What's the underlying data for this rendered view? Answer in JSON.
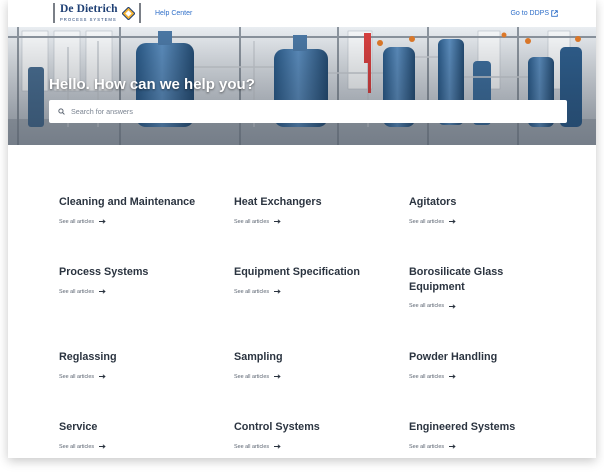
{
  "header": {
    "logo": {
      "brand": "De Dietrich",
      "subtitle": "PROCESS SYSTEMS",
      "icon": "diamond-logo-icon",
      "accent": "#f2b233"
    },
    "help_center": "Help Center",
    "go_to_ddps": "Go to DDPS",
    "external_icon": "external-link-icon"
  },
  "hero": {
    "title": "Hello. How can we help you?",
    "search": {
      "placeholder": "Search for answers",
      "value": "",
      "icon": "search-icon"
    }
  },
  "categories": [
    {
      "title": "Cleaning and Maintenance",
      "link": "See all articles"
    },
    {
      "title": "Heat Exchangers",
      "link": "See all articles"
    },
    {
      "title": "Agitators",
      "link": "See all articles"
    },
    {
      "title": "Process Systems",
      "link": "See all articles"
    },
    {
      "title": "Equipment Specification",
      "link": "See all articles"
    },
    {
      "title": "Borosilicate Glass Equipment",
      "link": "See all articles"
    },
    {
      "title": "Reglassing",
      "link": "See all articles"
    },
    {
      "title": "Sampling",
      "link": "See all articles"
    },
    {
      "title": "Powder Handling",
      "link": "See all articles"
    },
    {
      "title": "Service",
      "link": "See all articles"
    },
    {
      "title": "Control Systems",
      "link": "See all articles"
    },
    {
      "title": "Engineered Systems",
      "link": "See all articles"
    }
  ],
  "colors": {
    "link": "#2f6fc9",
    "text": "#2b3440",
    "brand": "#1e3f74",
    "vessel": "#3e6f9e"
  }
}
